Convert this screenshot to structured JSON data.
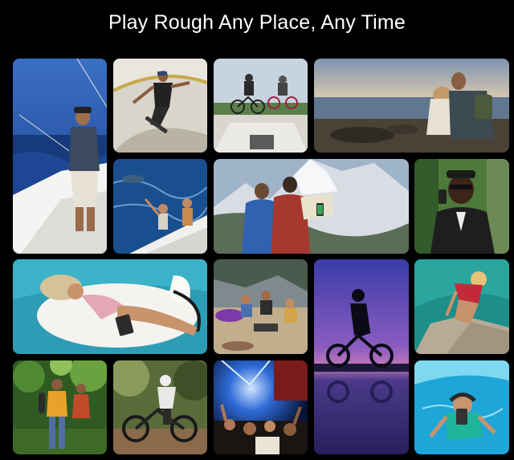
{
  "header": {
    "title": "Play Rough Any Place, Any Time"
  },
  "gallery": {
    "tiles": [
      {
        "id": "fishing-photo",
        "subject": "man fishing on a boat at sea"
      },
      {
        "id": "skateboard-photo",
        "subject": "skateboarder in a bowl"
      },
      {
        "id": "bmx-photo",
        "subject": "bmx riders jumping"
      },
      {
        "id": "beach-couple-photo",
        "subject": "couple sitting on rocky shore"
      },
      {
        "id": "dolphins-photo",
        "subject": "friends on boat with dolphins"
      },
      {
        "id": "hikers-map-photo",
        "subject": "hikers with map near snowy mountain"
      },
      {
        "id": "security-guard-photo",
        "subject": "security guard using phone"
      },
      {
        "id": "pool-float-photo",
        "subject": "woman lounging on pool float"
      },
      {
        "id": "camping-photo",
        "subject": "group camping outdoors"
      },
      {
        "id": "bike-sunset-photo",
        "subject": "cyclist silhouette at sunset"
      },
      {
        "id": "cliff-water-photo",
        "subject": "woman climbing rock by water"
      },
      {
        "id": "forest-hikers-photo",
        "subject": "hikers in forest"
      },
      {
        "id": "mountain-bike-photo",
        "subject": "mountain biker on trail"
      },
      {
        "id": "concert-photo",
        "subject": "concert crowd with lights"
      },
      {
        "id": "underwater-photo",
        "subject": "woman swimming underwater"
      }
    ]
  },
  "colors": {
    "background": "#000000",
    "title": "#ffffff"
  }
}
